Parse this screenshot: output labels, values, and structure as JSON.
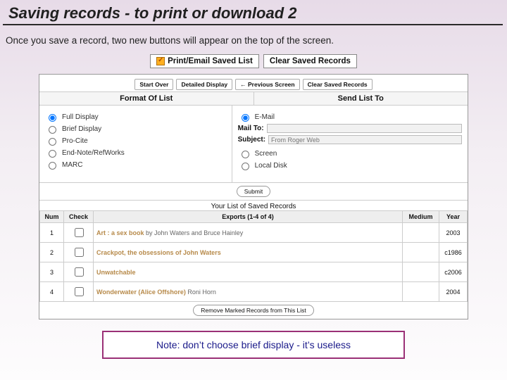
{
  "title": "Saving records - to print or download 2",
  "intro": "Once you save a record, two new buttons will appear on the top of the screen.",
  "top_buttons": {
    "print": "Print/Email Saved List",
    "clear": "Clear Saved Records"
  },
  "mini_buttons": {
    "start_over": "Start Over",
    "detailed": "Detailed Display",
    "previous": "← Previous Screen",
    "clear": "Clear Saved Records"
  },
  "cols": {
    "format": "Format Of List",
    "send": "Send List To"
  },
  "format_options": {
    "full": "Full Display",
    "brief": "Brief Display",
    "procite": "Pro-Cite",
    "endnote": "End-Note/RefWorks",
    "marc": "MARC"
  },
  "send_options": {
    "email": "E-Mail",
    "mail_to_label": "Mail To:",
    "subject_label": "Subject:",
    "subject_placeholder": "From Roger Web",
    "screen": "Screen",
    "local": "Local Disk"
  },
  "submit": "Submit",
  "saved_section": {
    "title": "Your List of Saved Records",
    "exports_head": "Exports (1-4 of 4)",
    "cols": {
      "num": "Num",
      "check": "Check",
      "medium": "Medium",
      "year": "Year"
    },
    "rows": [
      {
        "num": "1",
        "title_a": "Art : a sex book",
        "title_b": " by John Waters and Bruce Hainley",
        "year": "2003"
      },
      {
        "num": "2",
        "title_a": "Crackpot, the obsessions of John Waters",
        "title_b": "",
        "year": "c1986"
      },
      {
        "num": "3",
        "title_a": "Unwatchable",
        "title_b": "",
        "year": "c2006"
      },
      {
        "num": "4",
        "title_a": "Wonderwater (Alice Offshore)",
        "title_b": " Roni Horn",
        "year": "2004"
      }
    ],
    "remove": "Remove Marked Records from This List"
  },
  "note": "Note: don’t choose brief display - it’s useless"
}
